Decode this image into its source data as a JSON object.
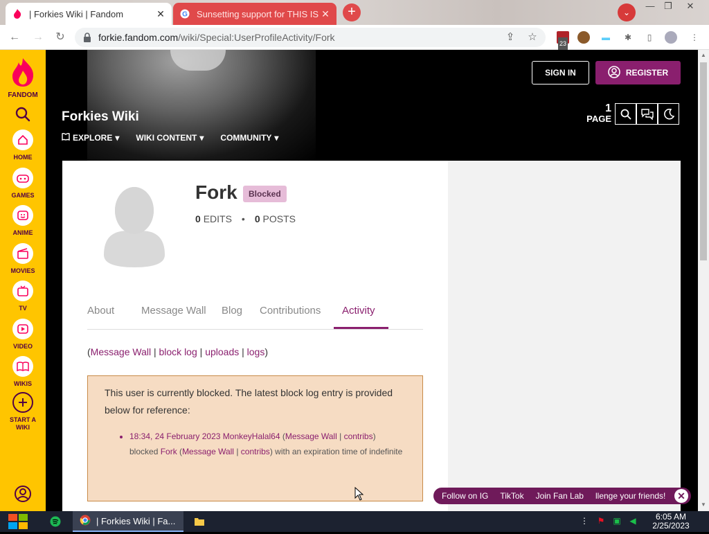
{
  "browser": {
    "tabs": [
      {
        "title": "| Forkies Wiki | Fandom",
        "active": true
      },
      {
        "title": "Sunsetting support for THIS IS",
        "active": false
      }
    ],
    "url_host": "forkie.fandom.com",
    "url_path": "/wiki/Special:UserProfileActivity/Fork",
    "extension_badge": "23"
  },
  "rail": {
    "logo_text": "FANDOM",
    "items": [
      {
        "label": "HOME",
        "icon": "home-icon"
      },
      {
        "label": "GAMES",
        "icon": "gamepad-icon"
      },
      {
        "label": "ANIME",
        "icon": "anime-icon"
      },
      {
        "label": "MOVIES",
        "icon": "clapperboard-icon"
      },
      {
        "label": "TV",
        "icon": "tv-icon"
      },
      {
        "label": "VIDEO",
        "icon": "play-icon"
      },
      {
        "label": "WIKIS",
        "icon": "book-icon"
      },
      {
        "label": "START A WIKI",
        "icon": "plus-icon"
      }
    ]
  },
  "header": {
    "sign_in": "SIGN IN",
    "register": "REGISTER",
    "wiki_title": "Forkies Wiki",
    "nav": [
      "EXPLORE",
      "WIKI CONTENT",
      "COMMUNITY"
    ],
    "page_count": "1",
    "page_label": "PAGE"
  },
  "profile": {
    "username": "Fork",
    "badge": "Blocked",
    "edits_count": "0",
    "edits_label": "EDITS",
    "posts_count": "0",
    "posts_label": "POSTS",
    "separator": "•",
    "tabs": [
      "About",
      "Message Wall",
      "Blog",
      "Contributions",
      "Activity"
    ],
    "active_tab": "Activity"
  },
  "tool_links": {
    "open": "(",
    "close": ")",
    "sep": "|",
    "items": [
      "Message Wall",
      "block log",
      "uploads",
      "logs"
    ]
  },
  "block_notice": {
    "message": "This user is currently blocked. The latest block log entry is provided below for reference:",
    "entry_time": "18:34, 24 February 2023",
    "entry_admin": "MonkeyHalal64",
    "admin_wall": "Message Wall",
    "admin_contribs": "contribs",
    "action": "blocked",
    "target": "Fork",
    "target_wall": "Message Wall",
    "target_contribs": "contribs",
    "expiry_text": "with an expiration time of indefinite"
  },
  "promo": {
    "items": [
      "Follow on IG",
      "TikTok",
      "Join Fan Lab",
      "llenge your friends!"
    ]
  },
  "taskbar": {
    "chrome_title": "| Forkies Wiki | Fa...",
    "time": "6:05 AM",
    "date": "2/25/2023"
  },
  "colors": {
    "fandom_yellow": "#ffc500",
    "fandom_purple": "#8a1f6e",
    "blocked_bg": "#f6dcc3"
  }
}
